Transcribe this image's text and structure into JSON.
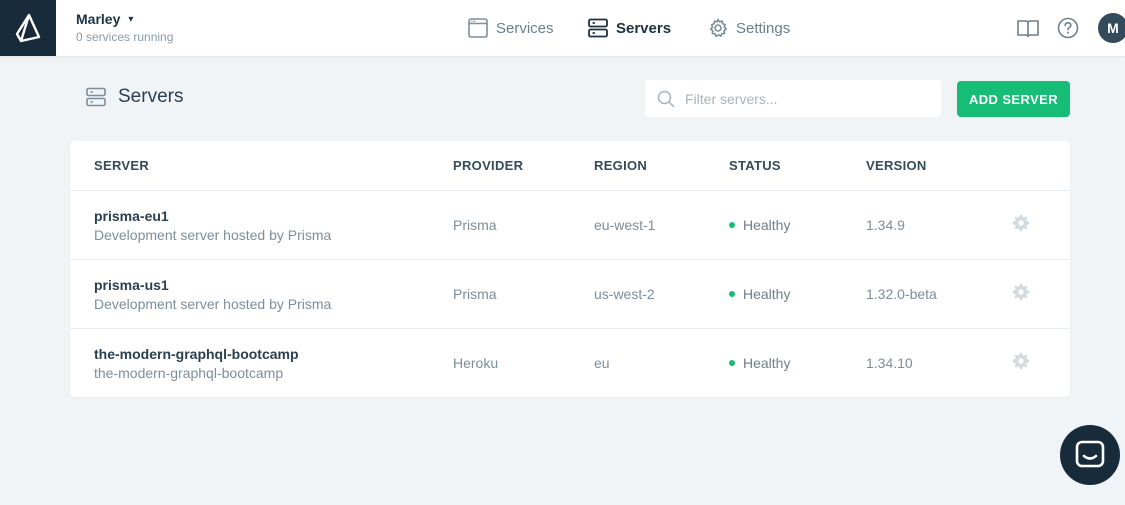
{
  "workspace": {
    "name": "Marley",
    "caret": "▾",
    "subtitle": "0 services running"
  },
  "nav": {
    "services": "Services",
    "servers": "Servers",
    "settings": "Settings"
  },
  "user": {
    "initial": "M"
  },
  "page": {
    "title": "Servers",
    "search_placeholder": "Filter servers...",
    "add_button": "ADD SERVER"
  },
  "table": {
    "headers": {
      "server": "SERVER",
      "provider": "PROVIDER",
      "region": "REGION",
      "status": "STATUS",
      "version": "VERSION"
    },
    "rows": [
      {
        "name": "prisma-eu1",
        "description": "Development server hosted by Prisma",
        "provider": "Prisma",
        "region": "eu-west-1",
        "status": "Healthy",
        "version": "1.34.9"
      },
      {
        "name": "prisma-us1",
        "description": "Development server hosted by Prisma",
        "provider": "Prisma",
        "region": "us-west-2",
        "status": "Healthy",
        "version": "1.32.0-beta"
      },
      {
        "name": "the-modern-graphql-bootcamp",
        "description": "the-modern-graphql-bootcamp",
        "provider": "Heroku",
        "region": "eu",
        "status": "Healthy",
        "version": "1.34.10"
      }
    ]
  },
  "colors": {
    "accent": "#15bd76",
    "dark": "#172b3a",
    "background": "#f1f4f7"
  },
  "icons": [
    "prisma-logo",
    "services-icon",
    "servers-icon",
    "settings-gear-icon",
    "docs-book-icon",
    "help-icon",
    "search-icon",
    "row-settings-gear-icon",
    "chat-icon"
  ]
}
